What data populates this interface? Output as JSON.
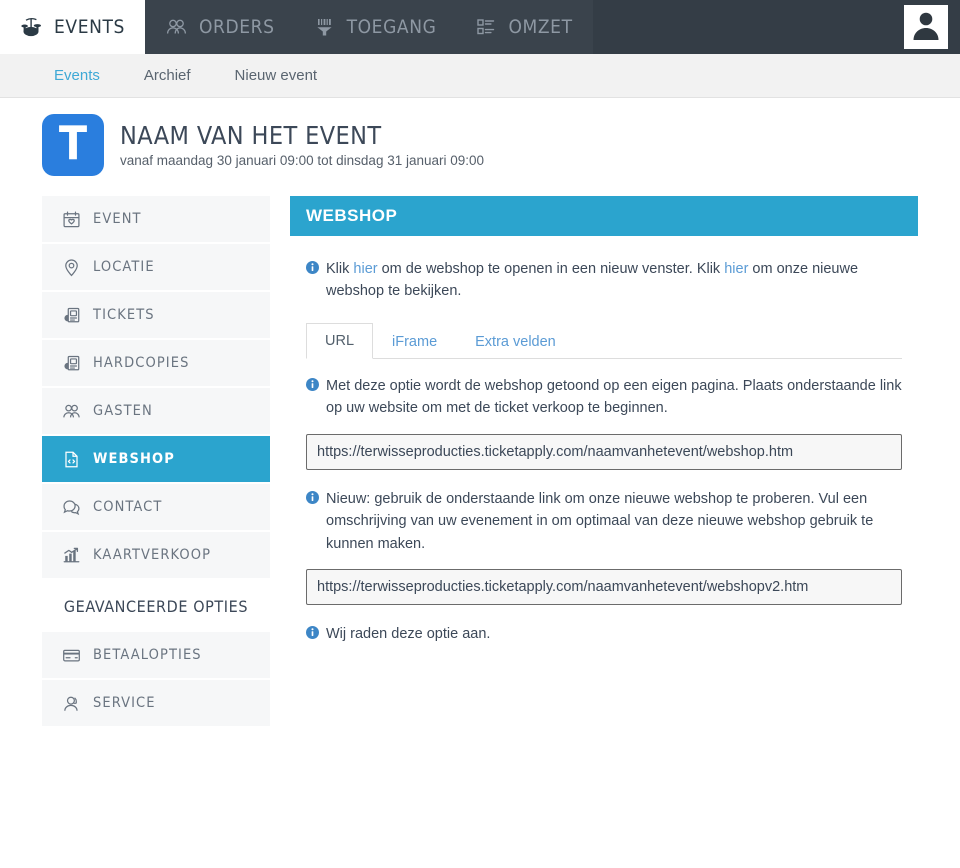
{
  "topnav": {
    "items": [
      {
        "label": "EVENTS",
        "icon": "drums-icon",
        "active": true
      },
      {
        "label": "ORDERS",
        "icon": "people-icon",
        "active": false
      },
      {
        "label": "TOEGANG",
        "icon": "scanner-icon",
        "active": false
      },
      {
        "label": "OMZET",
        "icon": "list-icon",
        "active": false
      }
    ],
    "avatar": "user-avatar-icon"
  },
  "subnav": {
    "items": [
      {
        "label": "Events",
        "active": true
      },
      {
        "label": "Archief",
        "active": false
      },
      {
        "label": "Nieuw event",
        "active": false
      }
    ]
  },
  "event": {
    "logo_letter": "T",
    "title": "NAAM VAN HET EVENT",
    "subtitle": "vanaf maandag 30 januari 09:00 tot dinsdag 31 januari 09:00"
  },
  "sidebar": {
    "items": [
      {
        "label": "EVENT",
        "icon": "calendar-icon",
        "active": false
      },
      {
        "label": "LOCATIE",
        "icon": "map-pin-icon",
        "active": false
      },
      {
        "label": "TICKETS",
        "icon": "ticket-icon",
        "active": false
      },
      {
        "label": "HARDCOPIES",
        "icon": "ticket-icon",
        "active": false
      },
      {
        "label": "GASTEN",
        "icon": "people-icon",
        "active": false
      },
      {
        "label": "WEBSHOP",
        "icon": "code-file-icon",
        "active": true
      },
      {
        "label": "CONTACT",
        "icon": "chat-bubble-icon",
        "active": false
      },
      {
        "label": "KAARTVERKOOP",
        "icon": "chart-growth-icon",
        "active": false
      }
    ],
    "section_title": "GEAVANCEERDE OPTIES",
    "advanced_items": [
      {
        "label": "BETAALOPTIES",
        "icon": "credit-card-icon",
        "active": false
      },
      {
        "label": "SERVICE",
        "icon": "headset-user-icon",
        "active": false
      }
    ]
  },
  "panel": {
    "title": "WEBSHOP",
    "intro": {
      "part1": "Klik ",
      "link1": "hier",
      "part2": " om de webshop te openen in een nieuw venster. Klik ",
      "link2": "hier",
      "part3": " om onze nieuwe webshop te bekijken."
    },
    "tabs": [
      {
        "label": "URL",
        "active": true
      },
      {
        "label": "iFrame",
        "active": false
      },
      {
        "label": "Extra velden",
        "active": false
      }
    ],
    "url_tab": {
      "info1": "Met deze optie wordt de webshop getoond op een eigen pagina. Plaats onderstaande link op uw website om met de ticket verkoop te beginnen.",
      "url1": "https://terwisseproducties.ticketapply.com/naamvanhetevent/webshop.htm",
      "info2": "Nieuw: gebruik de onderstaande link om onze nieuwe webshop te proberen. Vul een omschrijving van uw evenement in om optimaal van deze nieuwe webshop gebruik te kunnen maken.",
      "url2": "https://terwisseproducties.ticketapply.com/naamvanhetevent/webshopv2.htm",
      "info3": "Wij raden deze optie aan."
    }
  },
  "colors": {
    "topnav_bg": "#343d46",
    "accent_teal": "#2ba4ce",
    "link_blue": "#5b9bd5",
    "logo_blue": "#2a7ede",
    "sidebar_item_bg": "#f6f7f8"
  }
}
